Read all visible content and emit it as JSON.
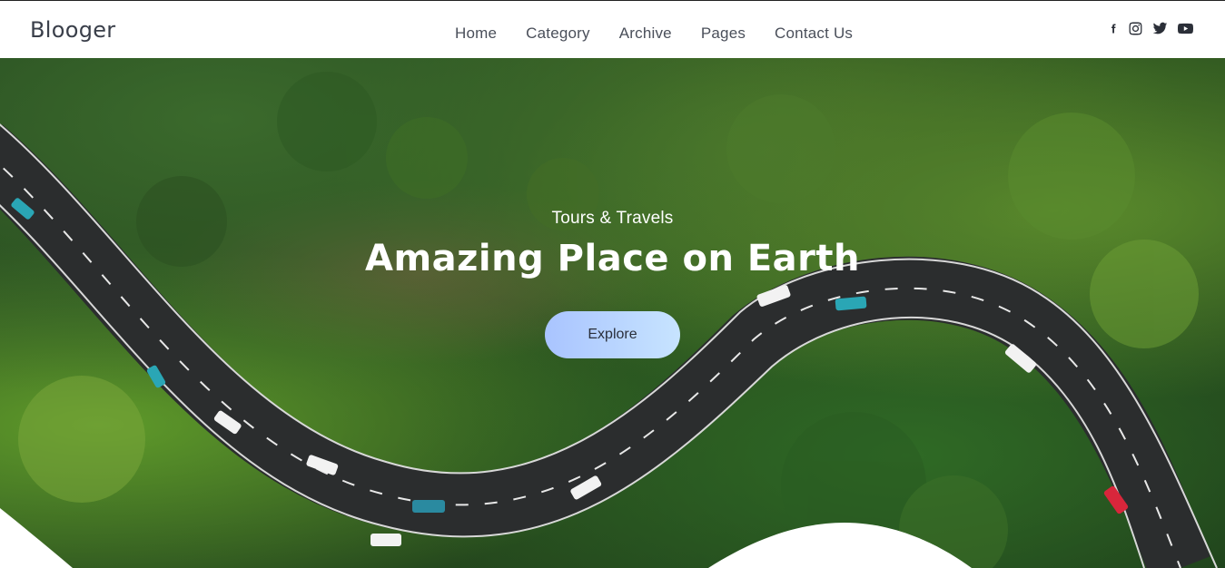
{
  "brand": {
    "name": "Blooger"
  },
  "nav": {
    "items": [
      {
        "label": "Home"
      },
      {
        "label": "Category"
      },
      {
        "label": "Archive"
      },
      {
        "label": "Pages"
      },
      {
        "label": "Contact Us"
      }
    ]
  },
  "social": {
    "icons": [
      "facebook-icon",
      "instagram-icon",
      "twitter-icon",
      "youtube-icon"
    ]
  },
  "hero": {
    "subtitle": "Tours & Travels",
    "title": "Amazing Place on Earth",
    "button_label": "Explore",
    "button_colors": [
      "#a9c4ff",
      "#c7e4ff"
    ]
  }
}
